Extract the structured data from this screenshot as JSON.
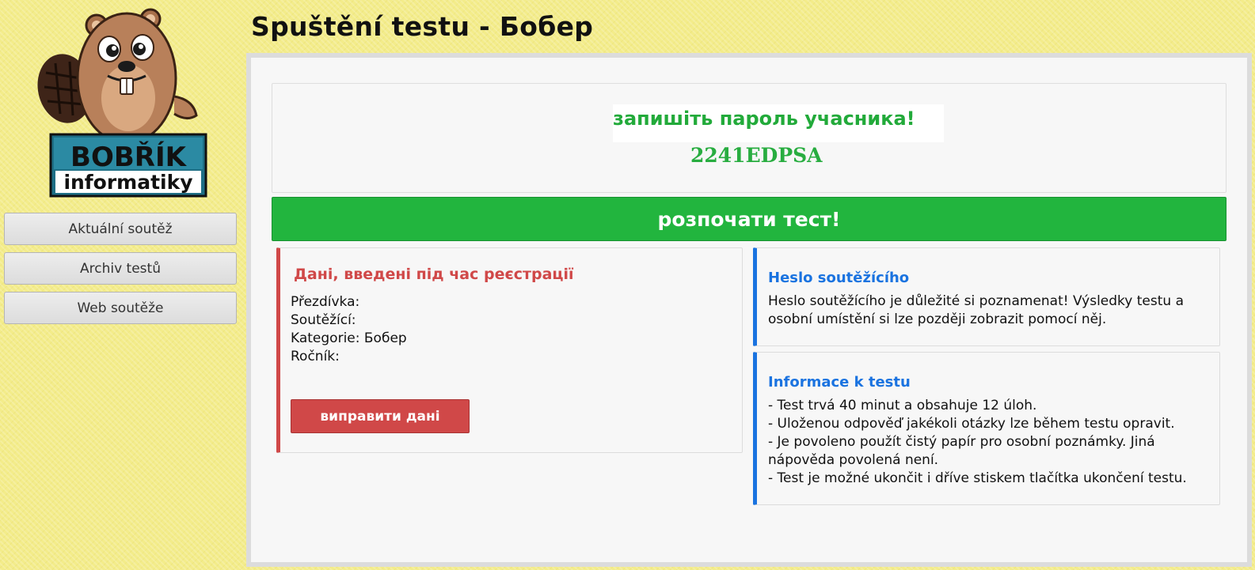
{
  "page": {
    "title": "Spuštění testu - Бобер"
  },
  "logo": {
    "line1": "BOBŘÍK",
    "line2": "informatiky"
  },
  "nav": {
    "items": [
      {
        "label": "Aktuální soutěž"
      },
      {
        "label": "Archiv testů"
      },
      {
        "label": "Web soutěže"
      }
    ]
  },
  "password": {
    "label": "запишіть пароль учасника!",
    "value": "2241EDPSA"
  },
  "start": {
    "label": "розпочати тест!"
  },
  "registration": {
    "title": "Дані, введені під час реєстрації",
    "fields": [
      {
        "label": "Přezdívka:",
        "value": ""
      },
      {
        "label": "Soutěžící:",
        "value": ""
      },
      {
        "label": "Kategorie:",
        "value": "Бобер"
      },
      {
        "label": "Ročník:",
        "value": ""
      }
    ],
    "edit_label": "виправити дані"
  },
  "heslo": {
    "title": "Heslo soutěžícího",
    "text": "Heslo soutěžícího je důležité si poznamenat! Výsledky testu a osobní umístění si lze později zobrazit pomocí něj."
  },
  "info": {
    "title": "Informace k testu",
    "lines": [
      "- Test trvá 40 minut a obsahuje 12 úloh.",
      "- Uloženou odpověď jakékoli otázky lze během testu opravit.",
      "- Je povoleno použít čistý papír pro osobní poznámky. Jiná nápověda povolená není.",
      "- Test je možné ukončit i dříve stiskem tlačítka ukončení testu."
    ]
  },
  "colors": {
    "background": "#f3ec8a",
    "success": "#22b53e",
    "danger": "#d04848",
    "primary": "#1a73e0"
  }
}
